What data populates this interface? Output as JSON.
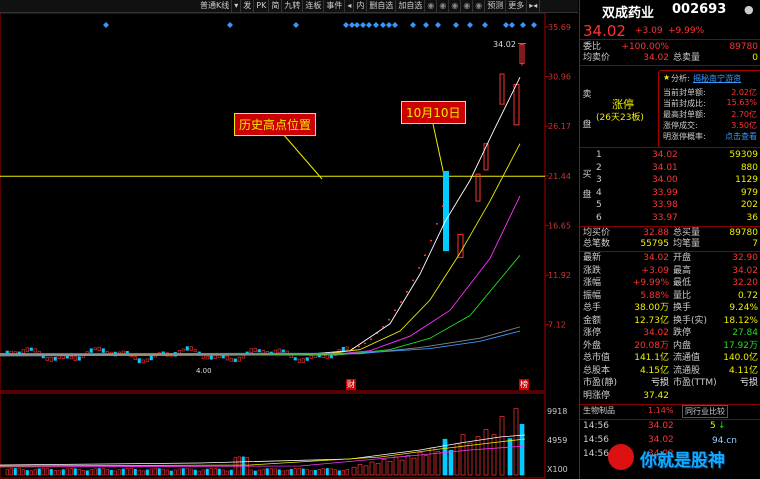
{
  "toolbar": {
    "items": [
      "普通K线",
      "▾",
      "发",
      "PK",
      "简",
      "九转",
      "连板",
      "事件",
      "◂",
      "内",
      "删自选",
      "加自选",
      "",
      "",
      "",
      "",
      "",
      "预测",
      "更多",
      "▸◂"
    ]
  },
  "chart": {
    "price_ticks": [
      "35.69",
      "30.96",
      "26.17",
      "21.44",
      "16.65",
      "11.92",
      "7.12",
      "4.00"
    ],
    "vol_ticks": [
      "9918",
      "4959",
      "X100"
    ],
    "top_label": "34.02",
    "annotation_history": "历史高点位置",
    "annotation_date": "10月10日",
    "marker_cai": "财",
    "marker_xiang": "榜"
  },
  "header": {
    "name": "双成药业",
    "code": "002693",
    "price": "34.02",
    "change": "+3.09",
    "pct": "+9.99%"
  },
  "weibi": {
    "label1": "委比",
    "v1": "+100.00%",
    "v2": "89780",
    "label2": "均卖价",
    "v3": "34.02",
    "label3": "总卖量",
    "v4": "0"
  },
  "limit_box": {
    "side_label": "卖\n盘",
    "title": "涨停",
    "subtitle": "(26天23板)",
    "analysis_label": "分析:",
    "analysis_value": "揭秘南宁游资",
    "items": [
      {
        "k": "当前封单额:",
        "v": "2.02亿"
      },
      {
        "k": "当前封成比:",
        "v": "15.63%"
      },
      {
        "k": "最高封单额:",
        "v": "2.70亿"
      },
      {
        "k": "涨停成交:",
        "v": "3.50亿"
      },
      {
        "k": "明涨停概率:",
        "v": "点击查看"
      }
    ]
  },
  "buy_side_label": "买\n盘",
  "buy_orders": [
    {
      "lvl": "1",
      "price": "34.02",
      "vol": "59309"
    },
    {
      "lvl": "2",
      "price": "34.01",
      "vol": "880"
    },
    {
      "lvl": "3",
      "price": "34.00",
      "vol": "1129"
    },
    {
      "lvl": "4",
      "price": "33.99",
      "vol": "979"
    },
    {
      "lvl": "5",
      "price": "33.98",
      "vol": "202"
    },
    {
      "lvl": "6",
      "price": "33.97",
      "vol": "36"
    }
  ],
  "buy_summary": {
    "k1": "均买价",
    "v1": "32.88",
    "k2": "总买量",
    "v2": "89780",
    "k3": "总笔数",
    "v3": "55795",
    "k4": "均笔量",
    "v4": "7"
  },
  "quote": [
    {
      "k1": "最新",
      "v1": "34.02",
      "c1": "red",
      "k2": "开盘",
      "v2": "32.90",
      "c2": "red"
    },
    {
      "k1": "涨跌",
      "v1": "+3.09",
      "c1": "red",
      "k2": "最高",
      "v2": "34.02",
      "c2": "red"
    },
    {
      "k1": "涨幅",
      "v1": "+9.99%",
      "c1": "red",
      "k2": "最低",
      "v2": "32.20",
      "c2": "red"
    },
    {
      "k1": "振幅",
      "v1": "5.88%",
      "c1": "red",
      "k2": "量比",
      "v2": "0.72",
      "c2": "yellow"
    },
    {
      "k1": "总手",
      "v1": "38.00万",
      "c1": "yellow",
      "k2": "换手",
      "v2": "9.24%",
      "c2": "yellow"
    },
    {
      "k1": "金额",
      "v1": "12.73亿",
      "c1": "yellow",
      "k2": "换手(实)",
      "v2": "18.12%",
      "c2": "yellow"
    },
    {
      "k1": "涨停",
      "v1": "34.02",
      "c1": "red",
      "k2": "跌停",
      "v2": "27.84",
      "c2": "green"
    },
    {
      "k1": "外盘",
      "v1": "20.08万",
      "c1": "red",
      "k2": "内盘",
      "v2": "17.92万",
      "c2": "green"
    },
    {
      "k1": "总市值",
      "v1": "141.1亿",
      "c1": "yellow",
      "k2": "流通值",
      "v2": "140.0亿",
      "c2": "yellow"
    },
    {
      "k1": "总股本",
      "v1": "4.15亿",
      "c1": "yellow",
      "k2": "流通股",
      "v2": "4.11亿",
      "c2": "yellow"
    },
    {
      "k1": "市盈(静)",
      "v1": "亏损",
      "c1": "white",
      "k2": "市盈(TTM)",
      "v2": "亏损",
      "c2": "white"
    },
    {
      "k1": "明涨停",
      "v1": "37.42",
      "c1": "yellow",
      "k2": "",
      "v2": "",
      "c2": "white"
    }
  ],
  "sector": {
    "name": "生物制品",
    "pct": "1.14%",
    "rank": "同行业比较"
  },
  "ticks": [
    {
      "t": "14:56",
      "p": "34.02",
      "v": "5",
      "arrow": "↓"
    },
    {
      "t": "14:56",
      "p": "34.02",
      "v": "",
      "arrow": ""
    },
    {
      "t": "14:56",
      "p": "34.02",
      "v": "",
      "arrow": ""
    }
  ],
  "watermark": "你就是股神",
  "watermark_url": "94.cn"
}
